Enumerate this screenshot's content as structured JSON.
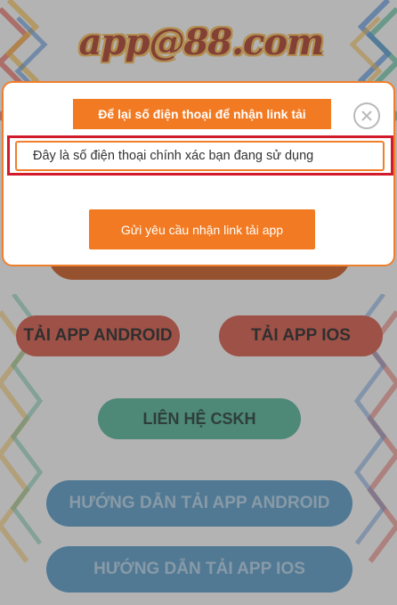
{
  "logo": {
    "text": "app@88.com"
  },
  "background_buttons": {
    "android": "TẢI APP ANDROID",
    "ios": "TẢI APP IOS",
    "support": "LIÊN HỆ CSKH",
    "guide_android": "HƯỚNG DẪN TẢI APP ANDROID",
    "guide_ios": "HƯỚNG DẪN TẢI APP IOS"
  },
  "modal": {
    "title": "Để lại số điện thoại để nhận link tải",
    "phone_placeholder": "Đây là số điện thoại chính xác bạn đang sử dụng",
    "submit_label": "Gửi yêu cầu nhận link tải app",
    "close_icon": "close-icon"
  },
  "colors": {
    "accent": "#f27a22",
    "android_button": "#cf4a3a",
    "support_button": "#46a98b",
    "guide_button": "#4a90bd",
    "highlight": "#d11a2a"
  }
}
